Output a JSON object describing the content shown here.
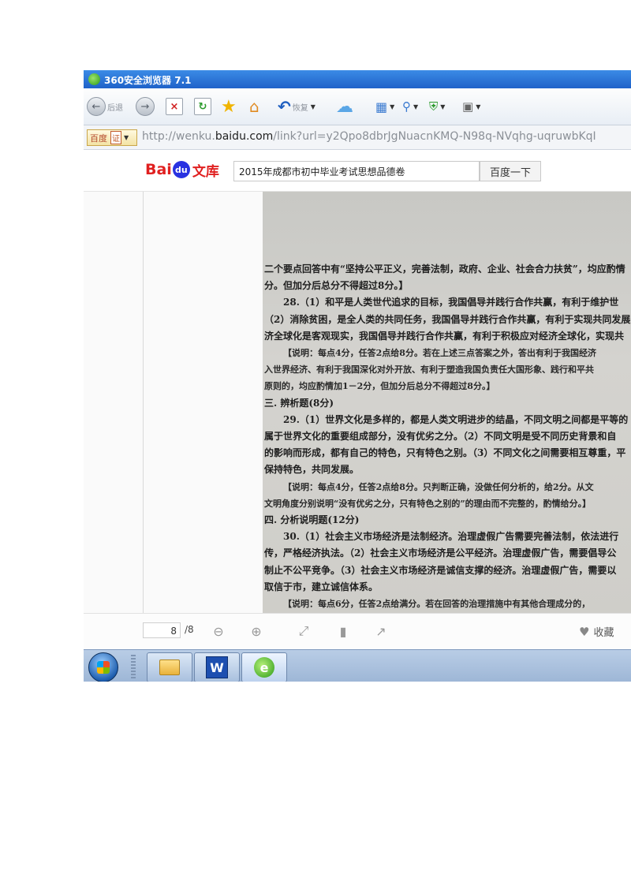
{
  "browser": {
    "title": "360安全浏览器 7.1",
    "back_label": "后退",
    "undo_label": "恢复"
  },
  "address": {
    "prefix_label": "百度",
    "cert_label": "证",
    "url_prefix": "http://wenku.",
    "url_domain": "baidu.com",
    "url_rest": "/link?url=y2Qpo8dbrJgNuacnKMQ-N98q-NVqhg-uqruwbKqI"
  },
  "wenku": {
    "logo_bai": "Bai",
    "logo_du": "du",
    "logo_wenku": "文库",
    "search_value": "2015年成都市初中毕业考试思想品德卷",
    "search_button": "百度一下"
  },
  "document": {
    "lines": [
      "二个要点回答中有“坚持公平正义，完善法制，政府、企业、社会合力扶贫”，均应酌情",
      "分。但加分后总分不得超过8分。】",
      "28.（1）和平是人类世代追求的目标，我国倡导并践行合作共赢，有利于维护世",
      "（2）消除贫困，是全人类的共同任务，我国倡导并践行合作共赢，有利于实现共同发展",
      "济全球化是客观现实，我国倡导并践行合作共赢，有利于积极应对经济全球化，实现共",
      "【说明：每点4分，任答2点给8分。若在上述三点答案之外，答出有利于我国经济",
      "入世界经济、有利于我国深化对外开放、有利于塑造我国负责任大国形象、践行和平共",
      "原则的，均应酌情加1－2分，但加分后总分不得超过8分。】",
      "三. 辨析题(8分)",
      "29.（1）世界文化是多样的，都是人类文明进步的结晶，不同文明之间都是平等的",
      "属于世界文化的重要组成部分，没有优劣之分。（2）不同文明是受不同历史背景和自",
      "的影响而形成，都有自己的特色，只有特色之别。（3）不同文化之间需要相互尊重，平",
      "保持特色，共同发展。",
      "【说明：每点4分，任答2点给8分。只判断正确，没做任何分析的，给2分。从文",
      "文明角度分别说明“没有优劣之分，只有特色之别的”的理由而不完整的，酌情给分。】",
      "四. 分析说明题(12分)",
      "30.（1）社会主义市场经济是法制经济。治理虚假广告需要完善法制，依法进行",
      "传，严格经济执法。（2）社会主义市场经济是公平经济。治理虚假广告，需要倡导公",
      "制止不公平竞争。（3）社会主义市场经济是诚信支撑的经济。治理虚假广告，需要以",
      "取信于市，建立诚信体系。",
      "【说明：每点6分，任答2点给满分。若在回答的治理措施中有其他合理成分的，"
    ]
  },
  "pager": {
    "current_page": "8",
    "total_pages": "/8",
    "favorite_label": "收藏"
  },
  "taskbar": {
    "apps": [
      "file-explorer",
      "wps-writer",
      "360-browser"
    ]
  }
}
